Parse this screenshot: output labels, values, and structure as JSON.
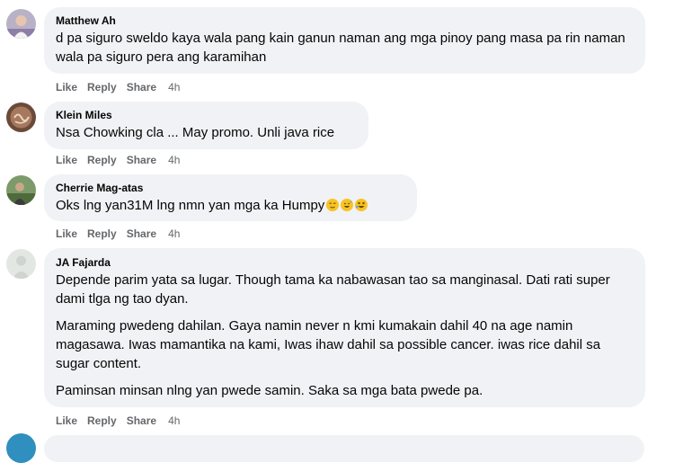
{
  "actions": {
    "like": "Like",
    "reply": "Reply",
    "share": "Share"
  },
  "comments": [
    {
      "author": "Matthew Ah",
      "paragraphs": [
        "d pa siguro sweldo kaya wala pang kain ganun naman ang mga pinoy pang masa pa rin naman wala pa siguro pera ang karamihan"
      ],
      "time": "4h"
    },
    {
      "author": "Klein Miles",
      "paragraphs": [
        "Nsa Chowking cla ... May promo. Unli java rice"
      ],
      "time": "4h"
    },
    {
      "author": "Cherrie Mag-atas",
      "paragraphs": [
        "Oks lng yan31M lng nmn yan mga ka Humpy"
      ],
      "emojis": [
        "relieved-face-emoji",
        "grinning-sweat-face-emoji",
        "rolling-laughing-face-emoji"
      ],
      "time": "4h"
    },
    {
      "author": "JA Fajarda",
      "paragraphs": [
        "Depende parim yata sa lugar. Though tama ka nabawasan tao sa manginasal. Dati rati super dami tlga ng tao dyan.",
        "Maraming pwedeng dahilan. Gaya namin never n kmi kumakain dahil 40 na age namin magasawa. Iwas mamantika na kami, Iwas ihaw dahil sa possible cancer. iwas rice dahil sa sugar content.",
        "Paminsan minsan nlng yan pwede samin. Saka sa mga bata pwede pa."
      ],
      "time": "4h"
    }
  ]
}
